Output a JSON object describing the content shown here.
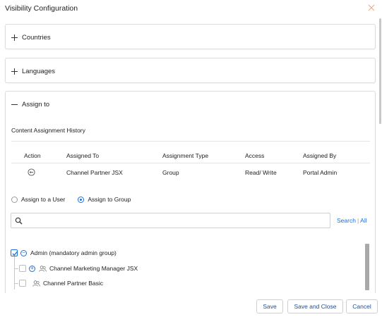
{
  "dialog": {
    "title": "Visibility Configuration"
  },
  "sections": {
    "countries": {
      "label": "Countries",
      "state": "collapsed"
    },
    "languages": {
      "label": "Languages",
      "state": "collapsed"
    },
    "assign_to": {
      "label": "Assign to",
      "state": "expanded"
    }
  },
  "history": {
    "title": "Content Assignment History",
    "columns": [
      "Action",
      "Assigned To",
      "Assignment Type",
      "Access",
      "Assigned By"
    ],
    "rows": [
      {
        "action_icon": "remove-circle-icon",
        "assigned_to": "Channel Partner JSX",
        "type": "Group",
        "access": "Read/ Write",
        "assigned_by": "Portal Admin"
      }
    ]
  },
  "assign_mode": {
    "options": [
      "Assign to a User",
      "Assign to Group"
    ],
    "selected": "Assign to Group"
  },
  "search": {
    "value": "",
    "placeholder": "",
    "search_label": "Search",
    "separator": "|",
    "all_label": "All"
  },
  "tree": [
    {
      "label": "Admin (mandatory admin group)",
      "checked": true,
      "toggle": "−"
    },
    {
      "label": "Channel Marketing Manager JSX",
      "checked": false,
      "toggle": "+"
    },
    {
      "label": "Channel Partner Basic",
      "checked": false,
      "toggle": ""
    }
  ],
  "footer": {
    "save": "Save",
    "save_close": "Save and Close",
    "cancel": "Cancel"
  },
  "colors": {
    "accent": "#1a6fe0",
    "button_text": "#1a4f9e",
    "close_icon": "#f0a78a"
  }
}
